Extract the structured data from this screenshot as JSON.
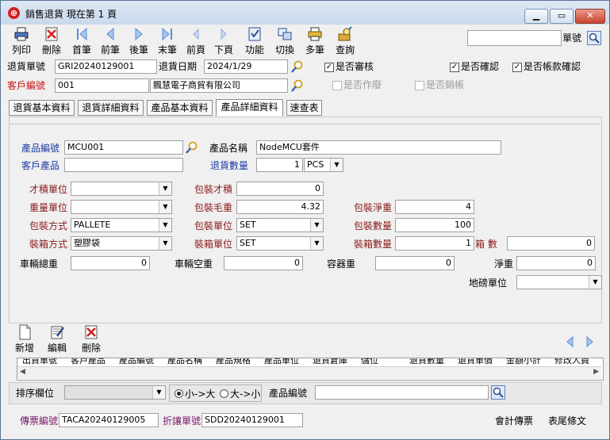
{
  "window": {
    "title": "銷售退貨  現在第 1 頁"
  },
  "toolbar": {
    "buttons": [
      {
        "label": "列印",
        "icon": "printer-icon"
      },
      {
        "label": "刪除",
        "icon": "delete-icon"
      },
      {
        "label": "首筆",
        "icon": "first-record-icon"
      },
      {
        "label": "前筆",
        "icon": "previous-record-icon"
      },
      {
        "label": "後筆",
        "icon": "next-record-icon"
      },
      {
        "label": "末筆",
        "icon": "last-record-icon"
      },
      {
        "label": "前頁",
        "icon": "previous-page-icon"
      },
      {
        "label": "下頁",
        "icon": "next-page-icon"
      },
      {
        "label": "功能",
        "icon": "function-icon"
      },
      {
        "label": "切換",
        "icon": "switch-icon"
      },
      {
        "label": "多筆",
        "icon": "multi-record-icon"
      },
      {
        "label": "查詢",
        "icon": "query-icon"
      }
    ],
    "doc_search_label": "單號",
    "doc_search_value": ""
  },
  "header": {
    "return_no_label": "退貨單號",
    "return_no": "GRI20240129001",
    "return_date_label": "退貨日期",
    "return_date": "2024/1/29",
    "customer_no_label": "客戶編號",
    "customer_no": "001",
    "customer_name": "飄慧電子商貿有限公司",
    "reviewed_label": "是否審核",
    "confirmed_label": "是否確認",
    "payment_confirmed_label": "是否帳款確認",
    "voided_label": "是否作廢",
    "closed_label": "是否銷帳",
    "check_mark": "✓"
  },
  "tabs": [
    {
      "label": "退貨基本資料"
    },
    {
      "label": "退貨詳細資料"
    },
    {
      "label": "產品基本資料"
    },
    {
      "label": "產品詳細資料"
    },
    {
      "label": "速查表"
    }
  ],
  "detail": {
    "product_code_label": "產品編號",
    "product_code": "MCU001",
    "product_name_label": "產品名稱",
    "product_name": "NodeMCU套件",
    "customer_product_label": "客戶產品",
    "customer_product": "",
    "return_qty_label": "退貨數量",
    "return_qty": "1",
    "return_unit": "PCS",
    "volume_unit_label": "才積單位",
    "volume_unit": "",
    "package_volume_label": "包裝才積",
    "package_volume": "0",
    "weight_unit_label": "重量單位",
    "weight_unit": "",
    "package_gross_label": "包裝毛重",
    "package_gross": "4.32",
    "package_net_label": "包裝淨重",
    "package_net": "4",
    "package_method_label": "包裝方式",
    "package_method": "PALLETE",
    "package_unit_label": "包裝單位",
    "package_unit": "SET",
    "package_qty_label": "包裝數量",
    "package_qty": "100",
    "boxing_method_label": "裝箱方式",
    "boxing_method": "塑膠袋",
    "boxing_unit_label": "裝箱單位",
    "boxing_unit": "SET",
    "boxing_qty_label": "裝箱數量",
    "boxing_qty": "1",
    "box_count_label": "箱 數",
    "box_count": "0",
    "vehicle_total_label": "車輛總重",
    "vehicle_total": "0",
    "vehicle_empty_label": "車輛空重",
    "vehicle_empty": "0",
    "container_weight_label": "容器重",
    "container_weight": "0",
    "net_weight_label": "淨重",
    "net_weight": "0",
    "scale_unit_label": "地磅單位",
    "scale_unit": ""
  },
  "grid_tools": {
    "add_label": "新增",
    "edit_label": "編輯",
    "delete_label": "刪除"
  },
  "grid": {
    "columns": [
      "出貨單號",
      "客戶產品",
      "產品編號",
      "產品名稱",
      "產品規格",
      "產品單位",
      "退貨倉庫",
      "儲位",
      "退貨數量",
      "退貨單價",
      "金額小計",
      "修改人員"
    ]
  },
  "sort": {
    "field_label": "排序欄位",
    "field_value": "",
    "asc_label": "小->大",
    "desc_label": "大->小",
    "product_code_label": "產品編號",
    "product_code_value": ""
  },
  "footer": {
    "voucher_no_label": "傳票編號",
    "voucher_no": "TACA20240129005",
    "discount_no_label": "折讓單號",
    "discount_no": "SDD20240129001",
    "accounting_voucher_label": "會計傳票",
    "tail_label": "表尾條文"
  },
  "colors": {
    "label_blue": "#1a3aa5",
    "label_red": "#c81010",
    "label_maroon": "#8b1a1a",
    "window_frame": "#5a7396"
  }
}
